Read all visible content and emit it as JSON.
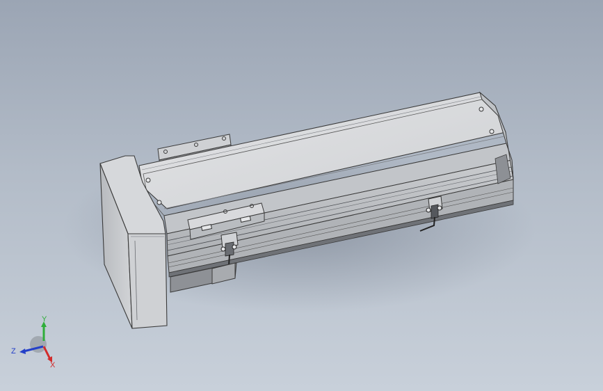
{
  "viewport": {
    "background_top": "#9ba5b4",
    "background_bottom": "#c8d0da"
  },
  "model": {
    "body_color": "#d4d6d9",
    "edge_color": "#3a3a3a",
    "dark_color": "#5c5f63"
  },
  "triad": {
    "x_label": "X",
    "y_label": "Y",
    "z_label": "Z",
    "x_color": "#d22b2b",
    "y_color": "#2fae3a",
    "z_color": "#2440c8"
  }
}
